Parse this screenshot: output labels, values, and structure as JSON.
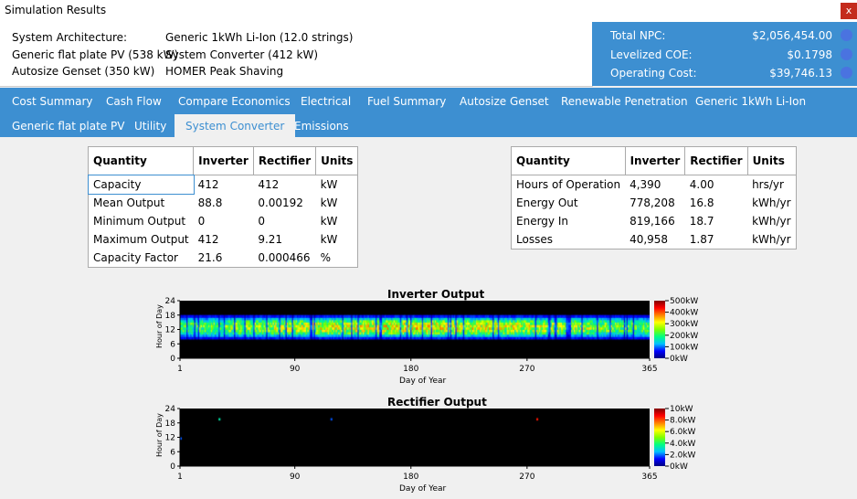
{
  "window": {
    "title": "Simulation Results",
    "close_label": "x"
  },
  "architecture": {
    "labels": [
      "System Architecture:",
      "Generic flat plate PV (538 kW)",
      "Autosize Genset (350 kW)"
    ],
    "values": [
      "Generic 1kWh Li-Ion (12.0 strings)",
      "System Converter (412 kW)",
      "HOMER Peak Shaving"
    ]
  },
  "summary": {
    "items": [
      {
        "label": "Total NPC:",
        "value": "$2,056,454.00"
      },
      {
        "label": "Levelized COE:",
        "value": "$0.1798"
      },
      {
        "label": "Operating Cost:",
        "value": "$39,746.13"
      }
    ]
  },
  "tabs": {
    "row1": [
      "Cost Summary",
      "Cash Flow",
      "Compare Economics",
      "Electrical",
      "Fuel Summary",
      "Autosize Genset",
      "Renewable Penetration",
      "Generic 1kWh Li-Ion"
    ],
    "row2": [
      "Generic flat plate PV",
      "Utility",
      "System Converter",
      "Emissions"
    ],
    "active": "System Converter"
  },
  "table_left": {
    "headers": [
      "Quantity",
      "Inverter",
      "Rectifier",
      "Units"
    ],
    "rows": [
      [
        "Capacity",
        "412",
        "412",
        "kW"
      ],
      [
        "Mean Output",
        "88.8",
        "0.00192",
        "kW"
      ],
      [
        "Minimum Output",
        "0",
        "0",
        "kW"
      ],
      [
        "Maximum Output",
        "412",
        "9.21",
        "kW"
      ],
      [
        "Capacity Factor",
        "21.6",
        "0.000466",
        "%"
      ]
    ]
  },
  "table_right": {
    "headers": [
      "Quantity",
      "Inverter",
      "Rectifier",
      "Units"
    ],
    "rows": [
      [
        "Hours of Operation",
        "4,390",
        "4.00",
        "hrs/yr"
      ],
      [
        "Energy Out",
        "778,208",
        "16.8",
        "kWh/yr"
      ],
      [
        "Energy In",
        "819,166",
        "18.7",
        "kWh/yr"
      ],
      [
        "Losses",
        "40,958",
        "1.87",
        "kWh/yr"
      ]
    ]
  },
  "chart_data": [
    {
      "type": "heatmap",
      "title": "Inverter Output",
      "xlabel": "Day of Year",
      "ylabel": "Hour of Day",
      "xticks": [
        "1",
        "90",
        "180",
        "270",
        "365"
      ],
      "yticks": [
        "0",
        "6",
        "12",
        "18",
        "24"
      ],
      "colorbar_ticks": [
        "0kW",
        "100kW",
        "200kW",
        "300kW",
        "400kW",
        "500kW"
      ],
      "xlim": [
        1,
        365
      ],
      "ylim": [
        0,
        24
      ],
      "zlim": [
        0,
        500
      ],
      "active_hours": [
        8,
        17
      ],
      "peak_hour": 12.5
    },
    {
      "type": "heatmap",
      "title": "Rectifier Output",
      "xlabel": "Day of Year",
      "ylabel": "Hour of Day",
      "xticks": [
        "1",
        "90",
        "180",
        "270",
        "365"
      ],
      "yticks": [
        "0",
        "6",
        "12",
        "18",
        "24"
      ],
      "colorbar_ticks": [
        "0kW",
        "2.0kW",
        "4.0kW",
        "6.0kW",
        "8.0kW",
        "10kW"
      ],
      "xlim": [
        1,
        365
      ],
      "ylim": [
        0,
        24
      ],
      "zlim": [
        0,
        10
      ],
      "points": [
        {
          "day": 31,
          "hour": 19,
          "value": 4
        },
        {
          "day": 118,
          "hour": 19,
          "value": 2
        },
        {
          "day": 278,
          "hour": 19,
          "value": 9
        },
        {
          "day": 1,
          "hour": 11,
          "value": 2
        }
      ]
    }
  ]
}
